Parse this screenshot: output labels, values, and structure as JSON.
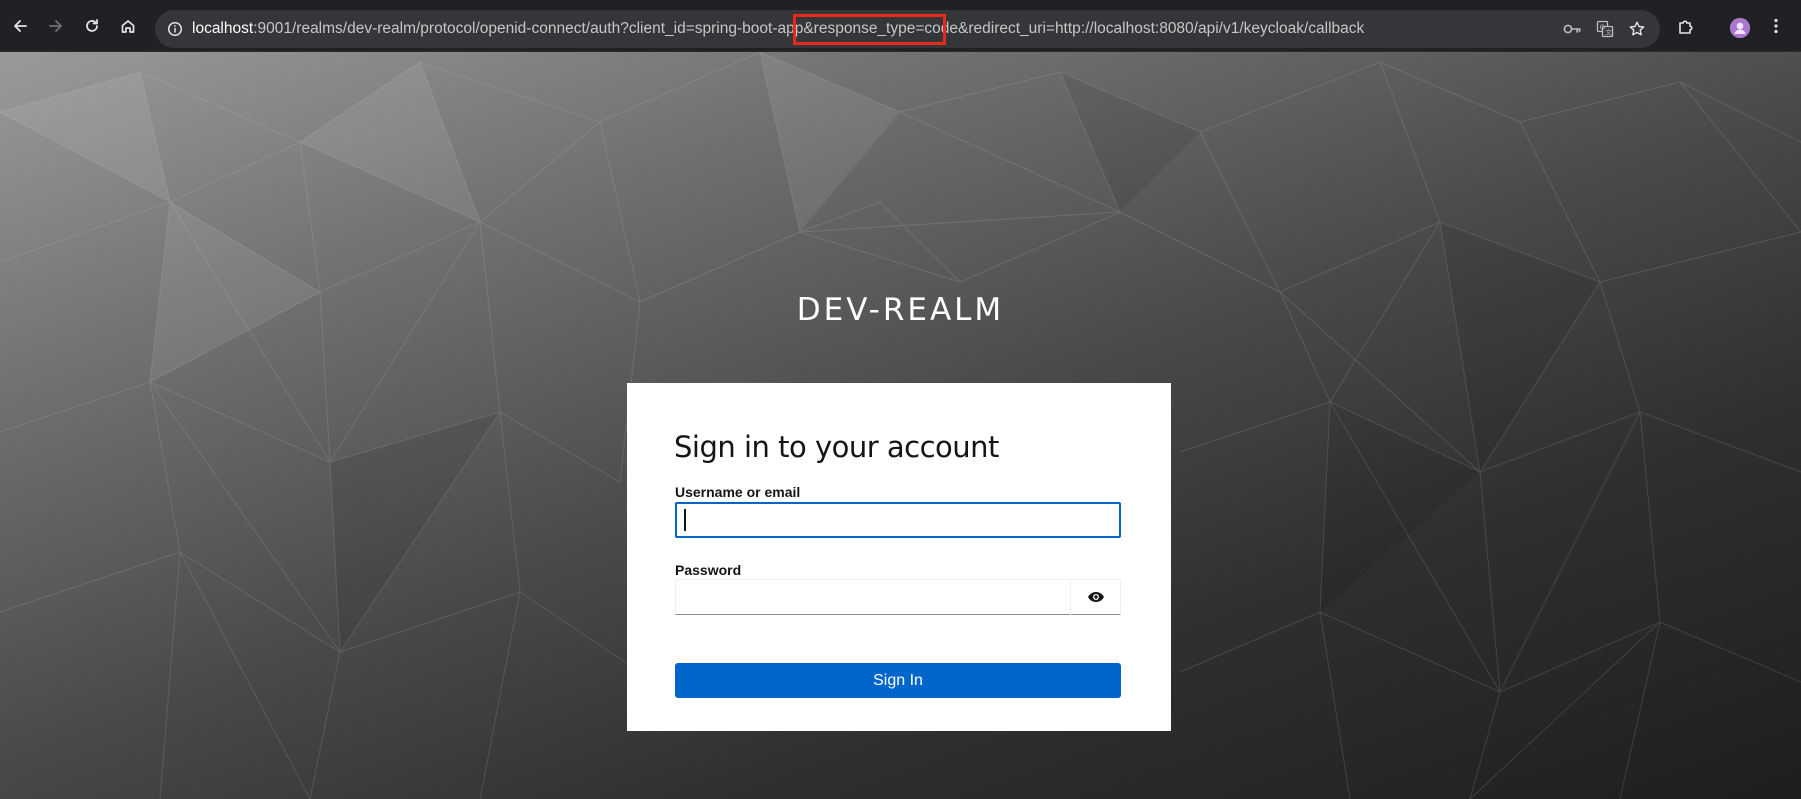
{
  "browser": {
    "url_host": "localhost",
    "url_rest": ":9001/realms/dev-realm/protocol/openid-connect/auth?client_id=spring-boot-app&response_type=code&redirect_uri=http://localhost:8080/api/v1/keycloak/callback",
    "highlight_color": "#e8291c",
    "icons": {
      "back": "arrow-left-icon",
      "forward": "arrow-right-icon",
      "reload": "reload-icon",
      "home": "home-icon",
      "site_info": "info-icon",
      "password_key": "key-icon",
      "translate": "translate-icon",
      "bookmark": "star-icon",
      "extensions": "puzzle-icon",
      "menu": "kebab-menu-icon"
    }
  },
  "login": {
    "realm_title": "DEV-REALM",
    "card_title": "Sign in to your account",
    "username_label": "Username or email",
    "username_value": "",
    "password_label": "Password",
    "password_value": "",
    "show_password_icon": "eye-icon",
    "sign_in_label": "Sign In",
    "accent_color": "#0066cc"
  }
}
